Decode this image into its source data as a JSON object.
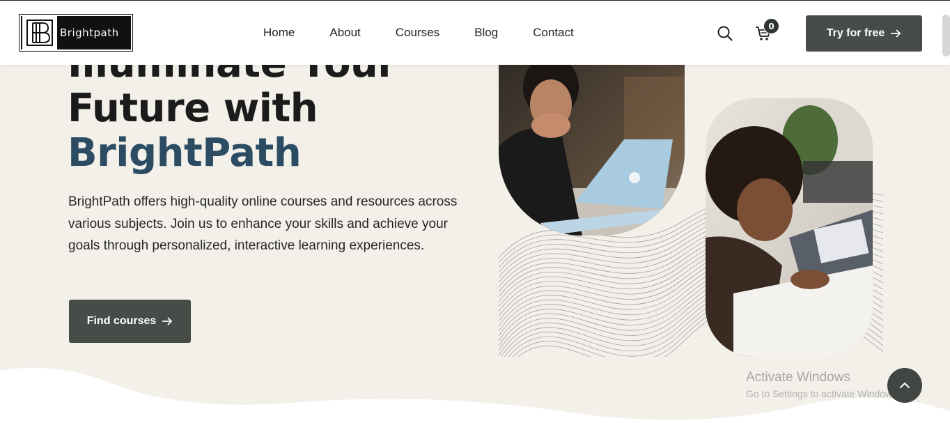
{
  "brand": {
    "name": "Brightpath"
  },
  "nav": {
    "items": [
      "Home",
      "About",
      "Courses",
      "Blog",
      "Contact"
    ]
  },
  "cart": {
    "count": "0"
  },
  "header_cta": {
    "label": "Try for free"
  },
  "hero": {
    "title_line1": "Illuminate Your",
    "title_line2": "Future with",
    "title_line3": "BrightPath",
    "description": "BrightPath offers high-quality online courses and resources across various subjects. Join us to enhance your skills and achieve your goals through personalized, interactive learning experiences.",
    "cta_label": "Find courses"
  },
  "windows_notice": {
    "title": "Activate Windows",
    "subtitle": "Go to Settings to activate Windows."
  },
  "colors": {
    "background": "#f3f0ea",
    "accent_title": "#2c4c63",
    "button": "#474c48",
    "header": "#ffffff"
  },
  "icons": [
    "search-icon",
    "cart-icon",
    "arrow-right-icon",
    "chevron-up-icon",
    "logo-icon"
  ]
}
